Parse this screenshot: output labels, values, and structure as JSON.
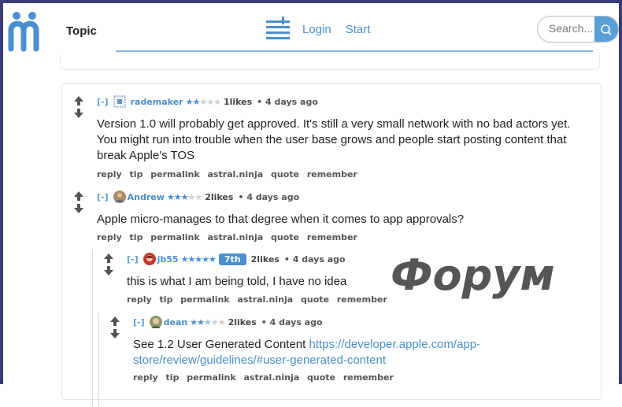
{
  "header": {
    "topic": "Topic",
    "nav": [
      "Login",
      "Start"
    ],
    "search_placeholder": "Search..."
  },
  "comments": [
    {
      "toggle": "[-]",
      "user": "rademaker",
      "stars": 2,
      "likes": "1likes",
      "age": "• 4 days ago",
      "text": "Version 1.0 will probably get approved. It's still a very small network with no bad actors yet. You might run into trouble when the user base grows and people start posting content that break Apple's TOS",
      "actions": [
        "reply",
        "tip",
        "permalink",
        "astral.ninja",
        "quote",
        "remember"
      ]
    },
    {
      "toggle": "[-]",
      "user": "Andrew",
      "stars": 3,
      "likes": "2likes",
      "age": "• 4 days ago",
      "text": "Apple micro-manages to that degree when it comes to app approvals?",
      "actions": [
        "reply",
        "tip",
        "permalink",
        "astral.ninja",
        "quote",
        "remember"
      ]
    },
    {
      "toggle": "[-]",
      "user": "jb55",
      "stars": 5,
      "badge": "7th",
      "likes": "2likes",
      "age": "• 4 days ago",
      "text": "this is what I am being told, I have no idea",
      "actions": [
        "reply",
        "tip",
        "permalink",
        "astral.ninja",
        "quote",
        "remember"
      ]
    },
    {
      "toggle": "[-]",
      "user": "dean",
      "stars": 2.5,
      "likes": "2likes",
      "age": "• 4 days ago",
      "text": "See 1.2 User Generated Content ",
      "link": "https://developer.apple.com/app-store/review/guidelines/#user-generated-content",
      "actions": [
        "reply",
        "tip",
        "permalink",
        "astral.ninja",
        "quote",
        "remember"
      ]
    }
  ],
  "watermark": "Форум",
  "colors": {
    "accent": "#4a8fcf",
    "frame": "#3b3b7a"
  }
}
